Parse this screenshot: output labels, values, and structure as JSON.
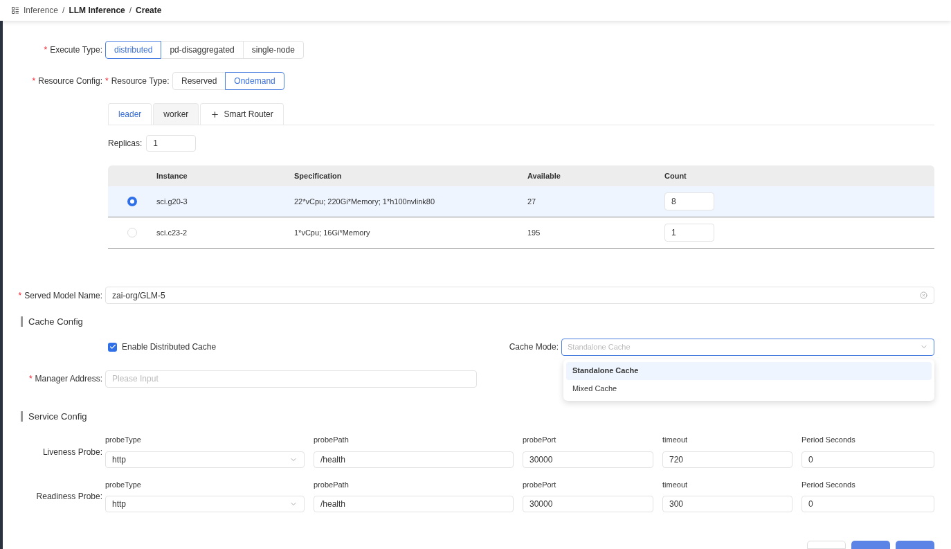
{
  "breadcrumb": [
    {
      "label": "Inference",
      "kind": "link"
    },
    {
      "separator": "/",
      "label": "LLM Inference",
      "kind": "page"
    },
    {
      "separator": "/",
      "label": "Create",
      "kind": "page"
    }
  ],
  "execute_type": {
    "label": "Execute Type:",
    "required_mark": "*",
    "options": [
      {
        "label": "distributed",
        "selected": true
      },
      {
        "label": "pd-disaggregated",
        "selected": false
      },
      {
        "label": "single-node",
        "selected": false
      }
    ]
  },
  "resource_config": {
    "label": "Resource Config:",
    "required_mark": "*",
    "resource_type": {
      "label": "Resource Type:",
      "required_mark": "*",
      "options": [
        {
          "label": "Reserved",
          "selected": false
        },
        {
          "label": "Ondemand",
          "selected": true
        }
      ]
    },
    "tabs": [
      {
        "label": "leader",
        "selected": true,
        "kind": "tab"
      },
      {
        "label": "worker",
        "selected": false,
        "kind": "tab"
      },
      {
        "label": "Smart Router",
        "selected": false,
        "kind": "add"
      }
    ],
    "replicas": {
      "label": "Replicas:",
      "value": "1"
    },
    "table": {
      "columns": [
        "Instance",
        "Specification",
        "Available",
        "Count"
      ],
      "rows": [
        {
          "selected": true,
          "instance": "sci.g20-3",
          "specification": "22*vCpu; 220Gi*Memory; 1*h100nvlink80",
          "available": "27",
          "count": "8"
        },
        {
          "selected": false,
          "instance": "sci.c23-2",
          "specification": "1*vCpu; 16Gi*Memory",
          "available": "195",
          "count": "1"
        }
      ]
    }
  },
  "served_model_name": {
    "label": "Served Model Name:",
    "required_mark": "*",
    "value": "zai-org/GLM-5"
  },
  "cache_config": {
    "title": "Cache Config",
    "enable_distributed_cache": {
      "label": "Enable Distributed Cache",
      "checked": true
    },
    "cache_mode": {
      "label": "Cache Mode:",
      "placeholder": "Standalone Cache",
      "expanded": true,
      "options": [
        {
          "label": "Standalone Cache",
          "selected": true
        },
        {
          "label": "Mixed Cache",
          "selected": false
        }
      ]
    },
    "manager_address": {
      "label": "Manager Address:",
      "required_mark": "*",
      "placeholder": "Please Input"
    }
  },
  "service_config": {
    "title": "Service Config",
    "probes": [
      {
        "label": "Liveness Probe:",
        "fields": [
          {
            "label": "probeType",
            "value": "http",
            "kind": "select"
          },
          {
            "label": "probePath",
            "value": "/health",
            "kind": "input"
          },
          {
            "label": "probePort",
            "value": "30000",
            "kind": "input"
          },
          {
            "label": "timeout",
            "value": "720",
            "kind": "input"
          },
          {
            "label": "Period Seconds",
            "value": "0",
            "kind": "input"
          }
        ]
      },
      {
        "label": "Readiness Probe:",
        "fields": [
          {
            "label": "probeType",
            "value": "http",
            "kind": "select"
          },
          {
            "label": "probePath",
            "value": "/health",
            "kind": "input"
          },
          {
            "label": "probePort",
            "value": "30000",
            "kind": "input"
          },
          {
            "label": "timeout",
            "value": "300",
            "kind": "input"
          },
          {
            "label": "Period Seconds",
            "value": "0",
            "kind": "input"
          }
        ]
      }
    ]
  },
  "footer_buttons": [
    {
      "kind": "default"
    },
    {
      "kind": "primary"
    },
    {
      "kind": "primary"
    }
  ]
}
